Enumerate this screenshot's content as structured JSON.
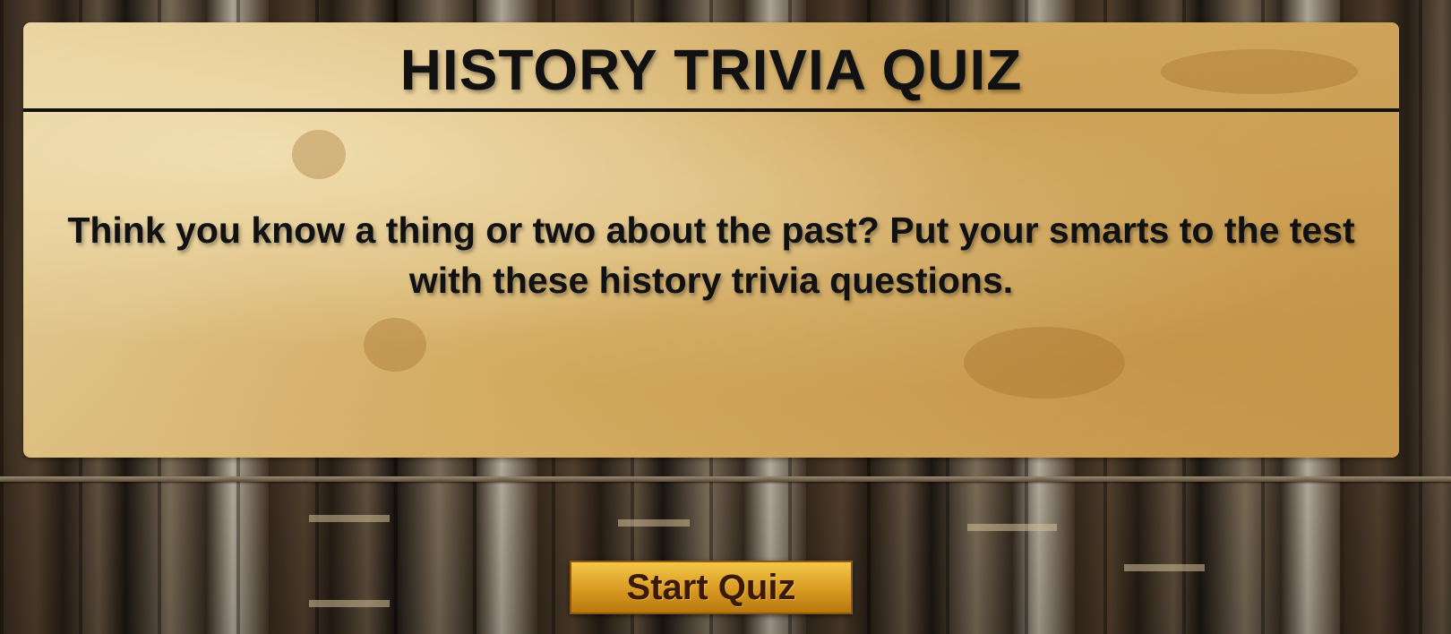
{
  "quiz": {
    "title": "HISTORY TRIVIA QUIZ",
    "description": "Think you know a thing or two about the past? Put your smarts to the test with these history trivia questions.",
    "start_label": "Start Quiz"
  },
  "theme": {
    "button_color": "#d89a22",
    "panel_color": "#d4ae68",
    "text_color": "#111111"
  }
}
